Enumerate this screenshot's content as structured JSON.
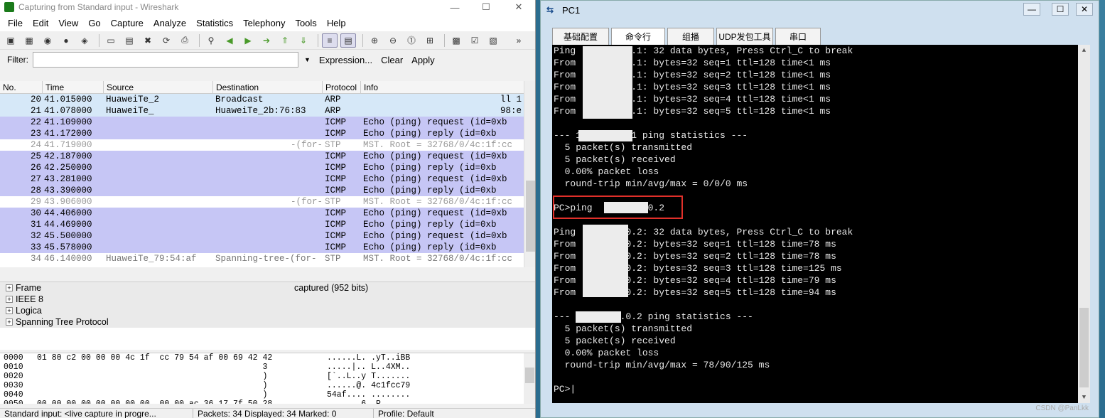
{
  "wireshark": {
    "title": "Capturing from Standard input - Wireshark",
    "menu": [
      "File",
      "Edit",
      "View",
      "Go",
      "Capture",
      "Analyze",
      "Statistics",
      "Telephony",
      "Tools",
      "Help"
    ],
    "filter": {
      "label": "Filter:",
      "value": "",
      "expression": "Expression...",
      "clear": "Clear",
      "apply": "Apply"
    },
    "columns": [
      "No.",
      "Time",
      "Source",
      "Destination",
      "Protocol",
      "Info"
    ],
    "packets": [
      {
        "no": "20",
        "time": "41.015000",
        "src": "HuaweiTe_2",
        "dst": "Broadcast",
        "proto": "ARP",
        "info": "ll 1",
        "kind": "arp"
      },
      {
        "no": "21",
        "time": "41.078000",
        "src": "HuaweiTe_",
        "dst": "HuaweiTe_2b:76:83",
        "proto": "ARP",
        "info": "98:e",
        "kind": "arp"
      },
      {
        "no": "22",
        "time": "41.109000",
        "src": "",
        "dst": "",
        "proto": "ICMP",
        "info": "Echo (ping) request  (id=0xb",
        "kind": "icmp"
      },
      {
        "no": "23",
        "time": "41.172000",
        "src": "",
        "dst": "",
        "proto": "ICMP",
        "info": "Echo (ping) reply    (id=0xb",
        "kind": "icmp"
      },
      {
        "no": "24",
        "time": "41.719000",
        "src": "",
        "dst": "-(for-",
        "proto": "STP",
        "info": "MST. Root = 32768/0/4c:1f:cc",
        "kind": "stp"
      },
      {
        "no": "25",
        "time": "42.187000",
        "src": "",
        "dst": "",
        "proto": "ICMP",
        "info": "Echo (ping) request  (id=0xb",
        "kind": "icmp"
      },
      {
        "no": "26",
        "time": "42.250000",
        "src": "",
        "dst": "",
        "proto": "ICMP",
        "info": "Echo (ping) reply    (id=0xb",
        "kind": "icmp"
      },
      {
        "no": "27",
        "time": "43.281000",
        "src": "",
        "dst": "",
        "proto": "ICMP",
        "info": "Echo (ping) request  (id=0xb",
        "kind": "icmp"
      },
      {
        "no": "28",
        "time": "43.390000",
        "src": "",
        "dst": "",
        "proto": "ICMP",
        "info": "Echo (ping) reply    (id=0xb",
        "kind": "icmp"
      },
      {
        "no": "29",
        "time": "43.906000",
        "src": "",
        "dst": "-(for-",
        "proto": "STP",
        "info": "MST. Root = 32768/0/4c:1f:cc",
        "kind": "stp"
      },
      {
        "no": "30",
        "time": "44.406000",
        "src": "",
        "dst": "",
        "proto": "ICMP",
        "info": "Echo (ping) request  (id=0xb",
        "kind": "icmp"
      },
      {
        "no": "31",
        "time": "44.469000",
        "src": "",
        "dst": "",
        "proto": "ICMP",
        "info": "Echo (ping) reply    (id=0xb",
        "kind": "icmp"
      },
      {
        "no": "32",
        "time": "45.500000",
        "src": "",
        "dst": "",
        "proto": "ICMP",
        "info": "Echo (ping) request  (id=0xb",
        "kind": "icmp"
      },
      {
        "no": "33",
        "time": "45.578000",
        "src": "",
        "dst": "",
        "proto": "ICMP",
        "info": "Echo (ping) reply    (id=0xb",
        "kind": "icmp"
      },
      {
        "no": "34",
        "time": "46.140000",
        "src": "HuaweiTe_79:54:af",
        "dst": "Spanning-tree-(for-",
        "proto": "STP",
        "info": "MST. Root = 32768/0/4c:1f:cc",
        "kind": "last"
      }
    ],
    "details": [
      {
        "label": "Frame",
        "extra": "captured (952 bits)"
      },
      {
        "label": "IEEE 8",
        "extra": ""
      },
      {
        "label": "Logica",
        "extra": ""
      },
      {
        "label": "Spanning Tree Protocol",
        "extra": ""
      }
    ],
    "bytes": [
      {
        "off": "0000",
        "hex": "01 80 c2 00 00 00 4c 1f  cc 79 54 af 00 69 42 42",
        "asc": "......L. .yT..iBB"
      },
      {
        "off": "0010",
        "hex": "                                              3",
        "asc": ".....|.. L..4XM.."
      },
      {
        "off": "0020",
        "hex": "                                              )",
        "asc": "[`..L..y T......."
      },
      {
        "off": "0030",
        "hex": "                                              )",
        "asc": "......@. 4c1fcc79"
      },
      {
        "off": "0040",
        "hex": "                                              )",
        "asc": "54af.... ........"
      },
      {
        "off": "0050",
        "hex": "00 00 00 00 00 00 00 00  00 00 ac 36 17 7f 50 28",
        "asc": "       6  P"
      }
    ],
    "status": {
      "input": "Standard input: <live capture in progre...",
      "packets": "Packets: 34 Displayed: 34 Marked: 0",
      "profile": "Profile: Default"
    }
  },
  "pc": {
    "title": "PC1",
    "tabs": [
      "基础配置",
      "命令行",
      "组播",
      "UDP发包工具",
      "串口"
    ],
    "active_tab": 1,
    "console_lines": [
      "Ping        .0.1: 32 data bytes, Press Ctrl_C to break",
      "From        .0.1: bytes=32 seq=1 ttl=128 time<1 ms",
      "From        .0.1: bytes=32 seq=2 ttl=128 time<1 ms",
      "From        .0.1: bytes=32 seq=3 ttl=128 time<1 ms",
      "From        .0.1: bytes=32 seq=4 ttl=128 time<1 ms",
      "From        .0.1: bytes=32 seq=5 ttl=128 time<1 ms",
      "",
      "--- 1       0.1 ping statistics ---",
      "  5 packet(s) transmitted",
      "  5 packet(s) received",
      "  0.00% packet loss",
      "  round-trip min/avg/max = 0/0/0 ms",
      "",
      "PC>ping         .0.2",
      "",
      "Ping        .0.2: 32 data bytes, Press Ctrl_C to break",
      "From        .0.2: bytes=32 seq=1 ttl=128 time=78 ms",
      "From        .0.2: bytes=32 seq=2 ttl=128 time=78 ms",
      "From        .0.2: bytes=32 seq=3 ttl=128 time=125 ms",
      "From        .0.2: bytes=32 seq=4 ttl=128 time=79 ms",
      "From        .0.2: bytes=32 seq=5 ttl=128 time=94 ms",
      "",
      "---        3.0.2 ping statistics ---",
      "  5 packet(s) transmitted",
      "  5 packet(s) received",
      "  0.00% packet loss",
      "  round-trip min/avg/max = 78/90/125 ms",
      "",
      "PC>|"
    ],
    "watermark": "CSDN @PanLkk"
  }
}
